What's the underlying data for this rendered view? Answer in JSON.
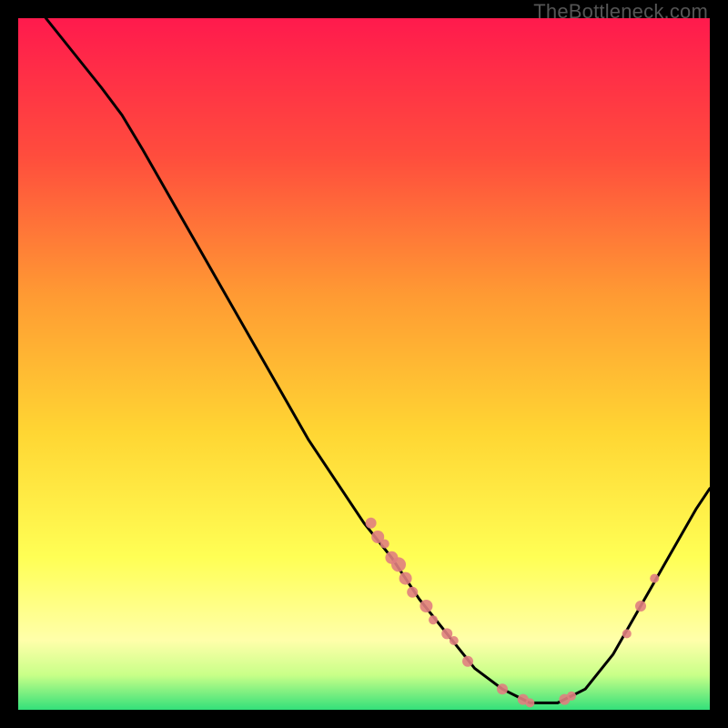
{
  "watermark": {
    "text": "TheBottleneck.com"
  },
  "chart_data": {
    "type": "line",
    "title": "",
    "xlabel": "",
    "ylabel": "",
    "xlim": [
      0,
      100
    ],
    "ylim": [
      0,
      100
    ],
    "grid": false,
    "legend": false,
    "background_gradient": {
      "top": "#ff1a4d",
      "mid_upper": "#ff7a33",
      "mid": "#ffd633",
      "lower": "#ffff66",
      "bottom": "#33e07a"
    },
    "curve": [
      {
        "x": 4,
        "y": 100
      },
      {
        "x": 8,
        "y": 95
      },
      {
        "x": 12,
        "y": 90
      },
      {
        "x": 15,
        "y": 86
      },
      {
        "x": 18,
        "y": 81
      },
      {
        "x": 22,
        "y": 74
      },
      {
        "x": 26,
        "y": 67
      },
      {
        "x": 30,
        "y": 60
      },
      {
        "x": 34,
        "y": 53
      },
      {
        "x": 38,
        "y": 46
      },
      {
        "x": 42,
        "y": 39
      },
      {
        "x": 46,
        "y": 33
      },
      {
        "x": 50,
        "y": 27
      },
      {
        "x": 54,
        "y": 22
      },
      {
        "x": 58,
        "y": 16
      },
      {
        "x": 62,
        "y": 11
      },
      {
        "x": 66,
        "y": 6
      },
      {
        "x": 70,
        "y": 3
      },
      {
        "x": 74,
        "y": 1
      },
      {
        "x": 78,
        "y": 1
      },
      {
        "x": 82,
        "y": 3
      },
      {
        "x": 86,
        "y": 8
      },
      {
        "x": 90,
        "y": 15
      },
      {
        "x": 94,
        "y": 22
      },
      {
        "x": 98,
        "y": 29
      },
      {
        "x": 100,
        "y": 32
      }
    ],
    "points": [
      {
        "x": 51,
        "y": 27,
        "r": 6
      },
      {
        "x": 52,
        "y": 25,
        "r": 7
      },
      {
        "x": 53,
        "y": 24,
        "r": 5
      },
      {
        "x": 54,
        "y": 22,
        "r": 7
      },
      {
        "x": 55,
        "y": 21,
        "r": 8
      },
      {
        "x": 56,
        "y": 19,
        "r": 7
      },
      {
        "x": 57,
        "y": 17,
        "r": 6
      },
      {
        "x": 59,
        "y": 15,
        "r": 7
      },
      {
        "x": 60,
        "y": 13,
        "r": 5
      },
      {
        "x": 62,
        "y": 11,
        "r": 6
      },
      {
        "x": 63,
        "y": 10,
        "r": 5
      },
      {
        "x": 65,
        "y": 7,
        "r": 6
      },
      {
        "x": 70,
        "y": 3,
        "r": 6
      },
      {
        "x": 73,
        "y": 1.5,
        "r": 6
      },
      {
        "x": 74,
        "y": 1,
        "r": 5
      },
      {
        "x": 79,
        "y": 1.5,
        "r": 6
      },
      {
        "x": 80,
        "y": 2,
        "r": 5
      },
      {
        "x": 88,
        "y": 11,
        "r": 5
      },
      {
        "x": 90,
        "y": 15,
        "r": 6
      },
      {
        "x": 92,
        "y": 19,
        "r": 5
      }
    ],
    "point_color": "#e08080",
    "curve_color": "#000000"
  }
}
